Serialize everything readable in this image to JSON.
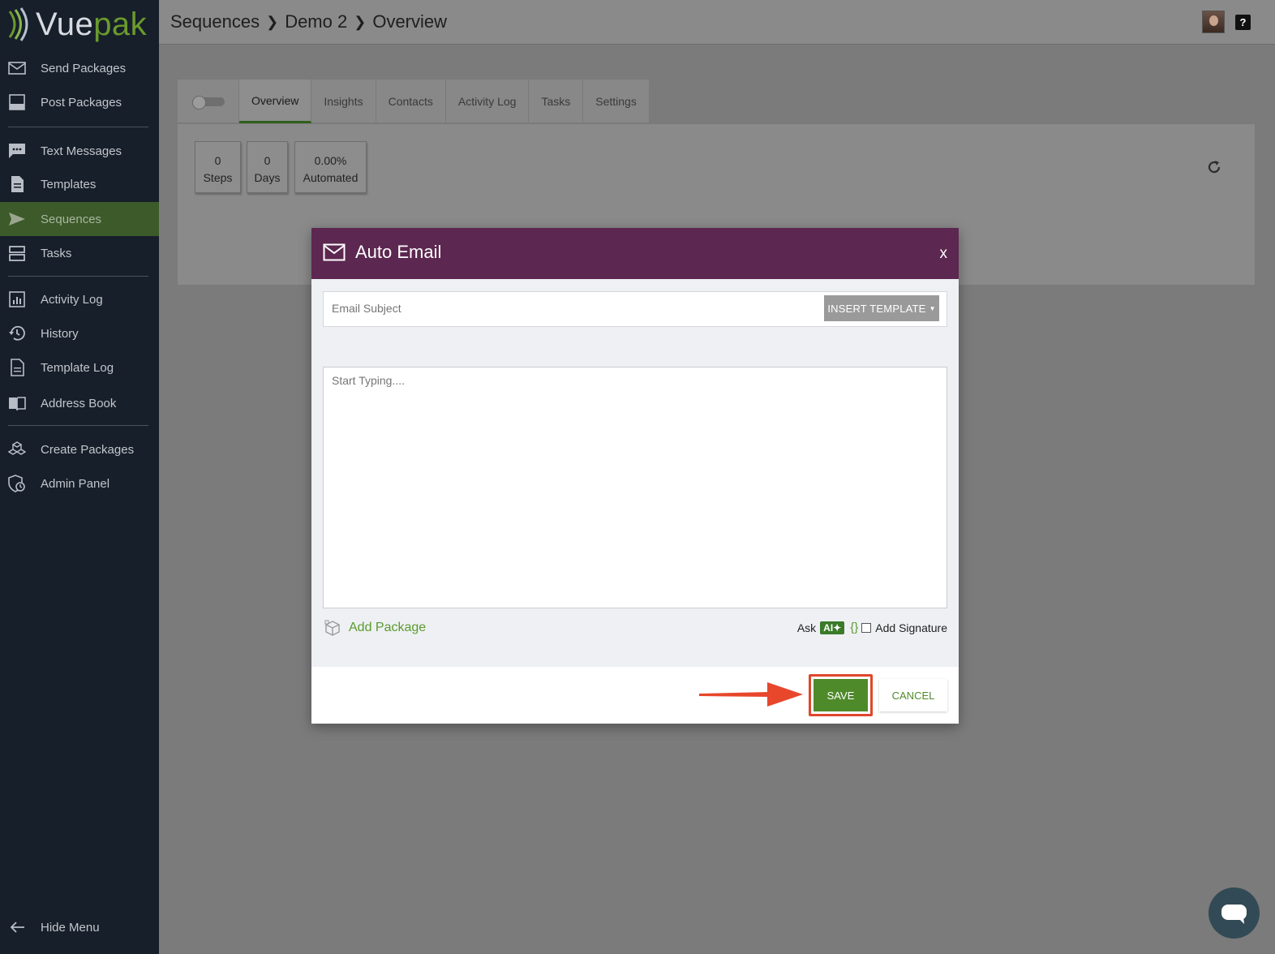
{
  "brand": {
    "name_part1": "Vue",
    "name_part2": "pak",
    "accent": "#6a9a2e"
  },
  "sidebar": {
    "items": [
      {
        "label": "Send Packages",
        "icon": "envelope-icon"
      },
      {
        "label": "Post Packages",
        "icon": "inbox-icon"
      },
      {
        "label": "Text Messages",
        "icon": "chat-icon"
      },
      {
        "label": "Templates",
        "icon": "document-icon"
      },
      {
        "label": "Sequences",
        "icon": "paper-plane-icon",
        "active": true
      },
      {
        "label": "Tasks",
        "icon": "server-icon"
      },
      {
        "label": "Activity Log",
        "icon": "bar-chart-icon"
      },
      {
        "label": "History",
        "icon": "history-icon"
      },
      {
        "label": "Template Log",
        "icon": "file-icon"
      },
      {
        "label": "Address Book",
        "icon": "book-icon"
      },
      {
        "label": "Create Packages",
        "icon": "boxes-icon"
      },
      {
        "label": "Admin Panel",
        "icon": "admin-shield-icon"
      }
    ],
    "hide_menu": "Hide Menu"
  },
  "header": {
    "breadcrumb": [
      "Sequences",
      "Demo 2",
      "Overview"
    ],
    "help_label": "?"
  },
  "tabs": [
    "Overview",
    "Insights",
    "Contacts",
    "Activity Log",
    "Tasks",
    "Settings"
  ],
  "stats": [
    {
      "value": "0",
      "label": "Steps"
    },
    {
      "value": "0",
      "label": "Days"
    },
    {
      "value": "0.00%",
      "label": "Automated"
    }
  ],
  "modal": {
    "title": "Auto Email",
    "close_label": "x",
    "subject_placeholder": "Email Subject",
    "insert_template_label": "INSERT TEMPLATE",
    "body_placeholder": "Start Typing....",
    "add_package_label": "Add Package",
    "ask_label": "Ask",
    "ai_label": "AI",
    "braces_label": "{}",
    "add_signature_label": "Add Signature",
    "save_label": "SAVE",
    "cancel_label": "CANCEL",
    "header_color": "#5c2750"
  }
}
